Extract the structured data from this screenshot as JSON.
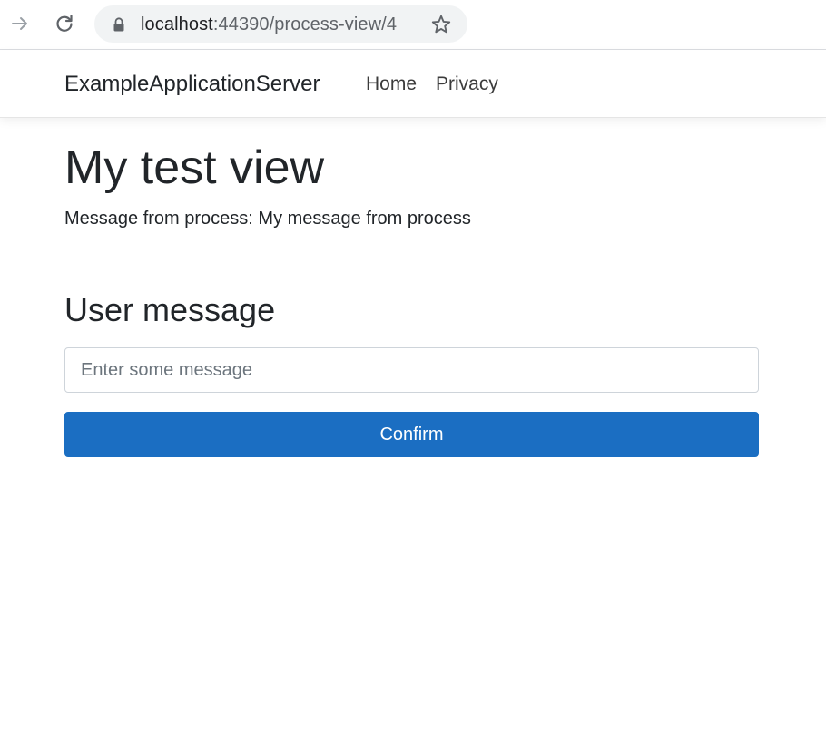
{
  "browser": {
    "url_host": "localhost",
    "url_rest": ":44390/process-view/4",
    "icons": {
      "forward": "arrow-right-icon",
      "reload": "reload-icon",
      "lock": "lock-icon",
      "bookmark": "star-icon"
    }
  },
  "navbar": {
    "brand": "ExampleApplicationServer",
    "links": [
      {
        "label": "Home"
      },
      {
        "label": "Privacy"
      }
    ]
  },
  "main": {
    "title": "My test view",
    "process_message": "Message from process: My message from process",
    "section_heading": "User message",
    "input": {
      "placeholder": "Enter some message",
      "value": ""
    },
    "confirm_label": "Confirm"
  },
  "colors": {
    "primary_button": "#1b6ec2",
    "text": "#212529"
  }
}
